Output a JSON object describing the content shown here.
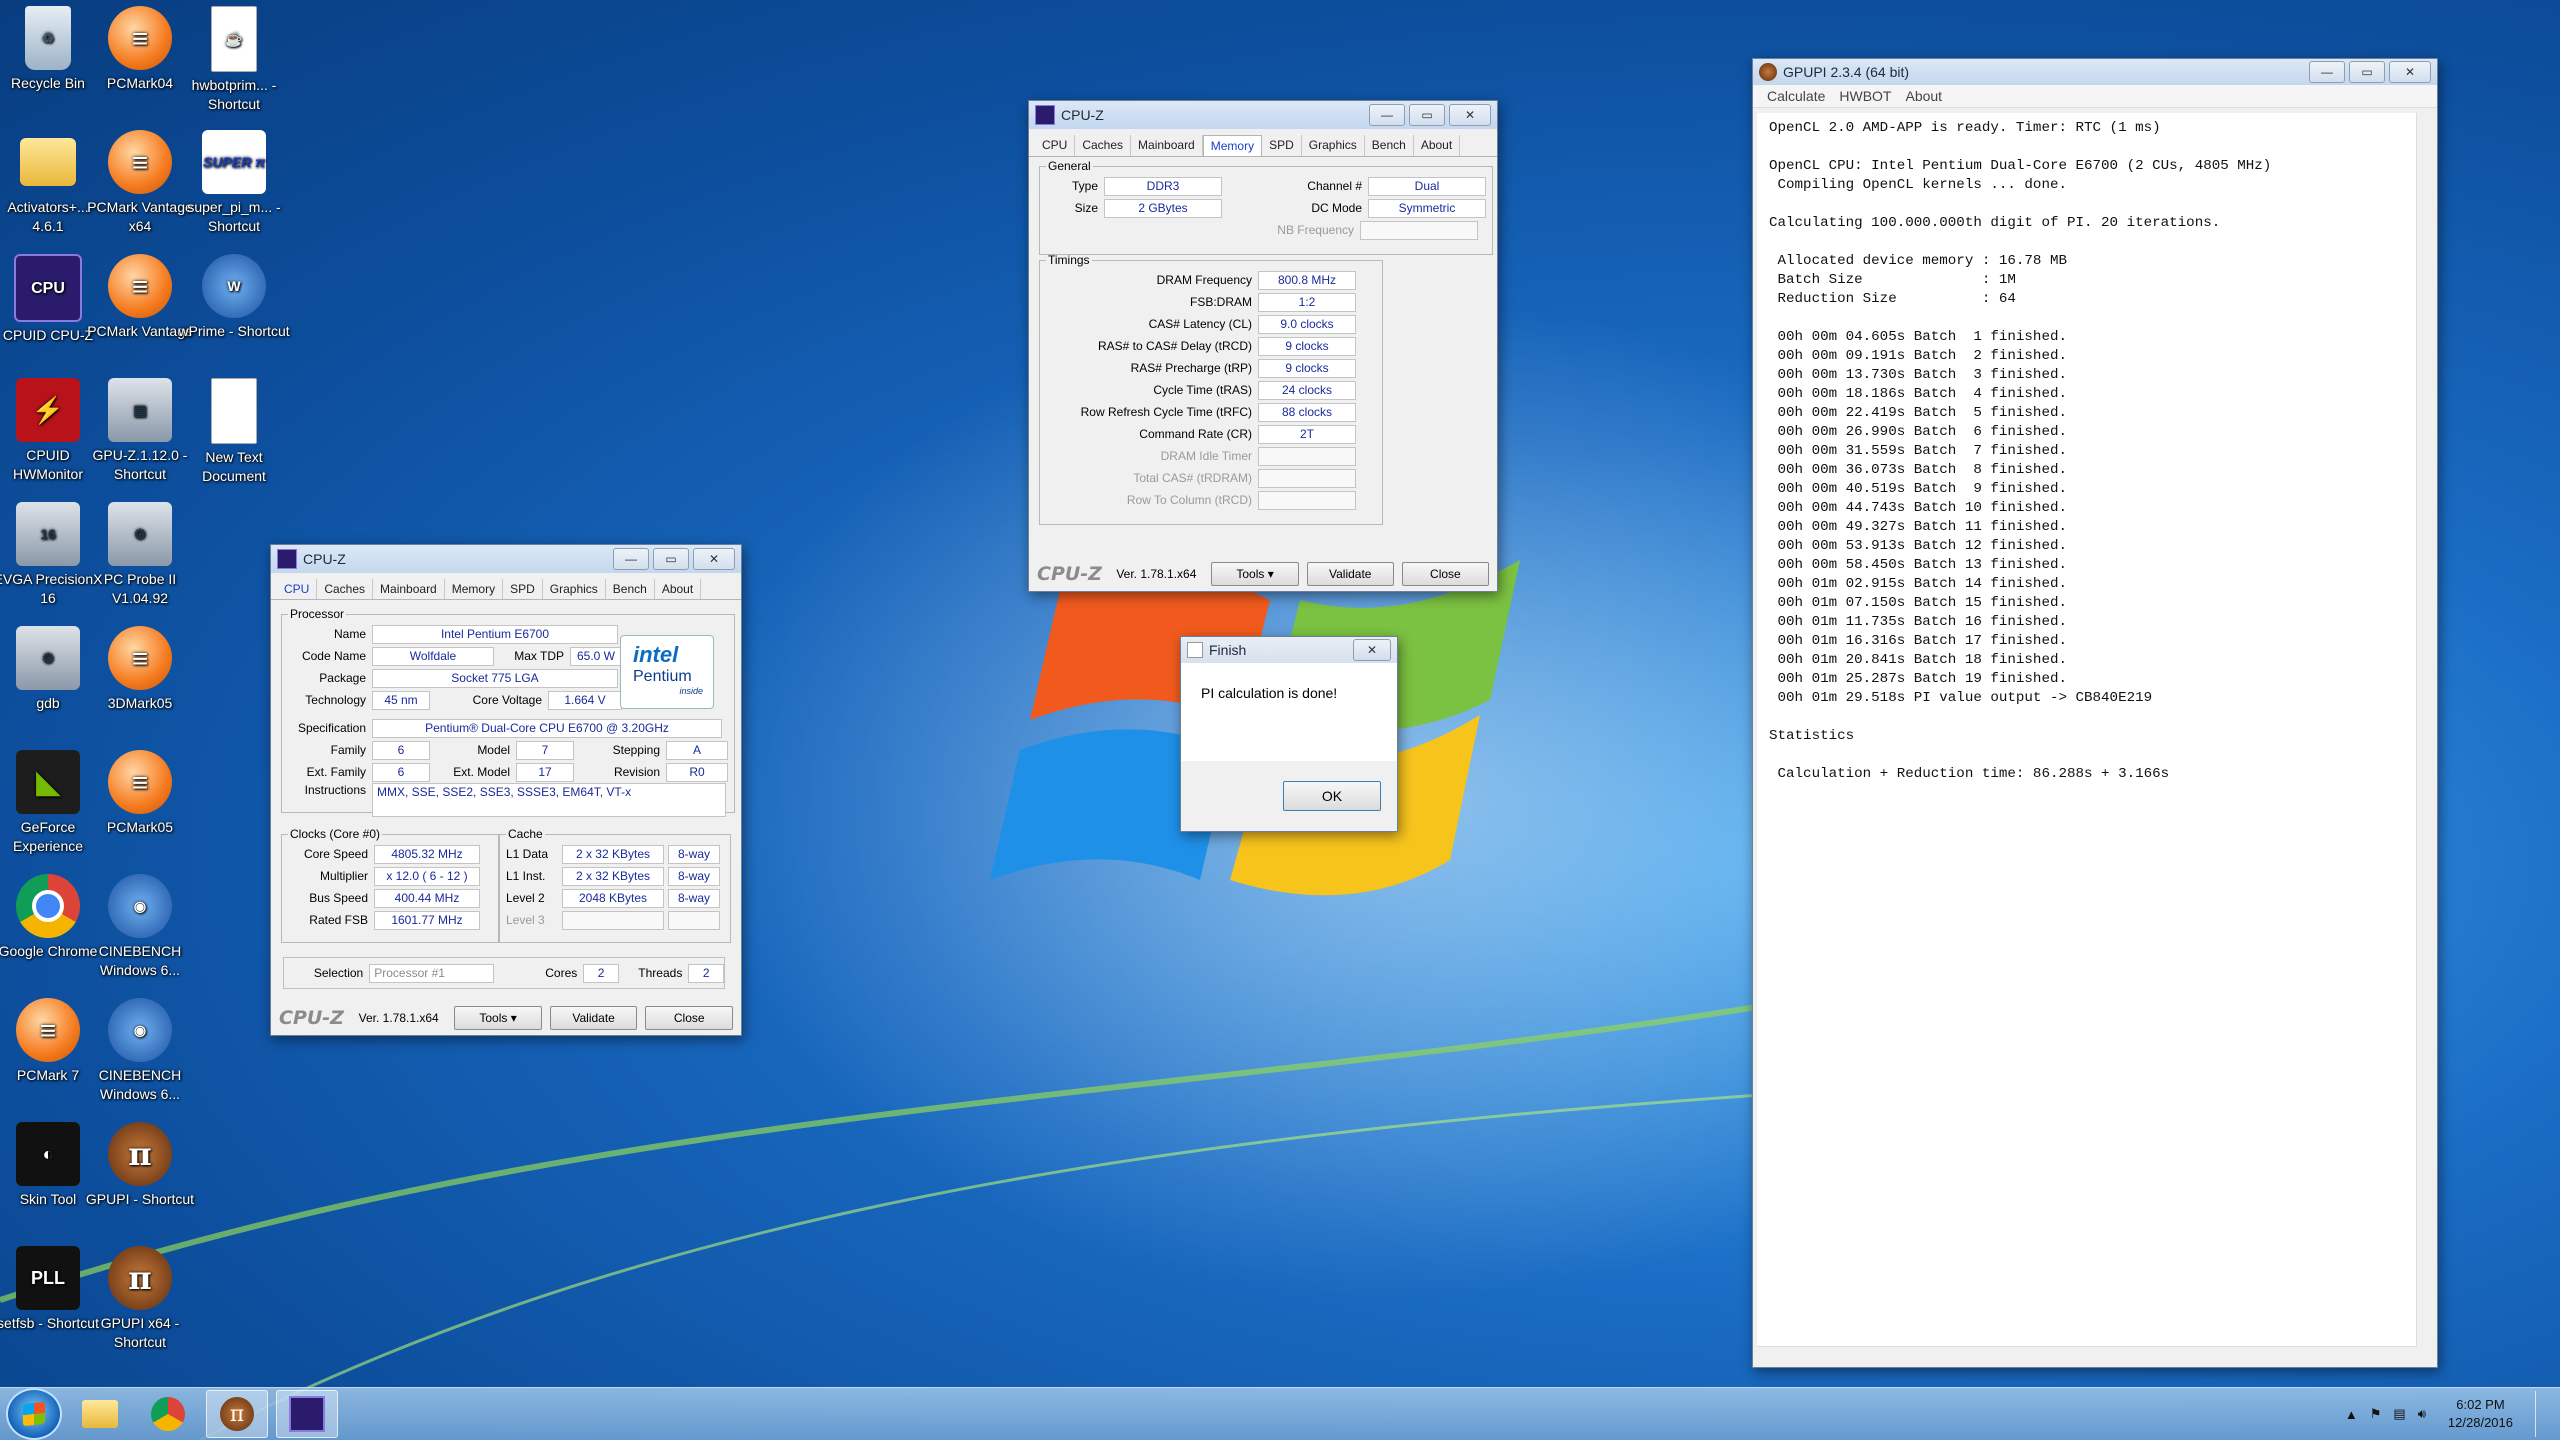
{
  "desktop_icons": [
    {
      "label": "Recycle Bin"
    },
    {
      "label": "PCMark04"
    },
    {
      "label": "hwbotprim... - Shortcut"
    },
    {
      "label": "Activators+... 4.6.1"
    },
    {
      "label": "PCMark Vantage x64"
    },
    {
      "label": "super_pi_m... - Shortcut"
    },
    {
      "label": "CPUID CPU-Z"
    },
    {
      "label": "PCMark Vantage"
    },
    {
      "label": "wPrime - Shortcut"
    },
    {
      "label": "CPUID HWMonitor"
    },
    {
      "label": "GPU-Z.1.12.0 - Shortcut"
    },
    {
      "label": "New Text Document"
    },
    {
      "label": "EVGA PrecisionX 16"
    },
    {
      "label": "PC Probe II V1.04.92"
    },
    {
      "label": "gdb"
    },
    {
      "label": "3DMark05"
    },
    {
      "label": "GeForce Experience"
    },
    {
      "label": "PCMark05"
    },
    {
      "label": "Google Chrome"
    },
    {
      "label": "CINEBENCH Windows 6..."
    },
    {
      "label": "PCMark 7"
    },
    {
      "label": "CINEBENCH Windows 6..."
    },
    {
      "label": "Skin Tool"
    },
    {
      "label": "GPUPI - Shortcut"
    },
    {
      "label": "setfsb - Shortcut"
    },
    {
      "label": "GPUPI x64 - Shortcut"
    }
  ],
  "cpuz_cpu": {
    "title": "CPU-Z",
    "tabs": [
      "CPU",
      "Caches",
      "Mainboard",
      "Memory",
      "SPD",
      "Graphics",
      "Bench",
      "About"
    ],
    "processor_legend": "Processor",
    "name_label": "Name",
    "name": "Intel Pentium E6700",
    "codename_label": "Code Name",
    "codename": "Wolfdale",
    "maxtdp_label": "Max TDP",
    "maxtdp": "65.0 W",
    "package_label": "Package",
    "package": "Socket 775 LGA",
    "tech_label": "Technology",
    "tech": "45 nm",
    "voltage_label": "Core Voltage",
    "voltage": "1.664 V",
    "spec_label": "Specification",
    "spec": "Pentium® Dual-Core  CPU     E6700  @ 3.20GHz",
    "family_label": "Family",
    "family": "6",
    "model_label": "Model",
    "model": "7",
    "stepping_label": "Stepping",
    "stepping": "A",
    "extfamily_label": "Ext. Family",
    "extfamily": "6",
    "extmodel_label": "Ext. Model",
    "extmodel": "17",
    "revision_label": "Revision",
    "revision": "R0",
    "instr_label": "Instructions",
    "instr": "MMX, SSE, SSE2, SSE3, SSSE3, EM64T, VT-x",
    "intel_logo_text": "intel",
    "intel_logo_sub": "Pentium",
    "intel_logo_inside": "inside",
    "clocks_legend": "Clocks (Core #0)",
    "corespeed_label": "Core Speed",
    "corespeed": "4805.32 MHz",
    "multiplier_label": "Multiplier",
    "multiplier": "x 12.0 ( 6 - 12 )",
    "busspeed_label": "Bus Speed",
    "busspeed": "400.44 MHz",
    "ratedfsb_label": "Rated FSB",
    "ratedfsb": "1601.77 MHz",
    "cache_legend": "Cache",
    "l1data_label": "L1 Data",
    "l1data": "2 x 32 KBytes",
    "l1data_way": "8-way",
    "l1inst_label": "L1 Inst.",
    "l1inst": "2 x 32 KBytes",
    "l1inst_way": "8-way",
    "l2_label": "Level 2",
    "l2": "2048 KBytes",
    "l2_way": "8-way",
    "l3_label": "Level 3",
    "selection_label": "Selection",
    "selection": "Processor #1",
    "cores_label": "Cores",
    "cores": "2",
    "threads_label": "Threads",
    "threads": "2",
    "brand": "CPU-Z",
    "version": "Ver. 1.78.1.x64",
    "tools": "Tools",
    "validate": "Validate",
    "close": "Close"
  },
  "cpuz_mem": {
    "title": "CPU-Z",
    "tabs": [
      "CPU",
      "Caches",
      "Mainboard",
      "Memory",
      "SPD",
      "Graphics",
      "Bench",
      "About"
    ],
    "general_legend": "General",
    "type_label": "Type",
    "type": "DDR3",
    "channel_label": "Channel #",
    "channel": "Dual",
    "size_label": "Size",
    "size": "2 GBytes",
    "dcmode_label": "DC Mode",
    "dcmode": "Symmetric",
    "nbfreq_label": "NB Frequency",
    "timings_legend": "Timings",
    "timings": [
      {
        "label": "DRAM Frequency",
        "value": "800.8 MHz",
        "dim": false
      },
      {
        "label": "FSB:DRAM",
        "value": "1:2",
        "dim": false
      },
      {
        "label": "CAS# Latency (CL)",
        "value": "9.0 clocks",
        "dim": false
      },
      {
        "label": "RAS# to CAS# Delay (tRCD)",
        "value": "9 clocks",
        "dim": false
      },
      {
        "label": "RAS# Precharge (tRP)",
        "value": "9 clocks",
        "dim": false
      },
      {
        "label": "Cycle Time (tRAS)",
        "value": "24 clocks",
        "dim": false
      },
      {
        "label": "Row Refresh Cycle Time (tRFC)",
        "value": "88 clocks",
        "dim": false
      },
      {
        "label": "Command Rate (CR)",
        "value": "2T",
        "dim": false
      },
      {
        "label": "DRAM Idle Timer",
        "value": "",
        "dim": true
      },
      {
        "label": "Total CAS# (tRDRAM)",
        "value": "",
        "dim": true
      },
      {
        "label": "Row To Column (tRCD)",
        "value": "",
        "dim": true
      }
    ],
    "brand": "CPU-Z",
    "version": "Ver. 1.78.1.x64",
    "tools": "Tools",
    "validate": "Validate",
    "close": "Close"
  },
  "finish_dialog": {
    "title": "Finish",
    "message": "PI calculation is done!",
    "ok": "OK"
  },
  "gpupi": {
    "title": "GPUPI 2.3.4 (64 bit)",
    "menu": [
      "Calculate",
      "HWBOT",
      "About"
    ],
    "log": [
      "OpenCL 2.0 AMD-APP is ready. Timer: RTC (1 ms)",
      "",
      "OpenCL CPU: Intel Pentium Dual-Core E6700 (2 CUs, 4805 MHz)",
      " Compiling OpenCL kernels ... done.",
      "",
      "Calculating 100.000.000th digit of PI. 20 iterations.",
      "",
      " Allocated device memory : 16.78 MB",
      " Batch Size              : 1M",
      " Reduction Size          : 64",
      "",
      " 00h 00m 04.605s Batch  1 finished.",
      " 00h 00m 09.191s Batch  2 finished.",
      " 00h 00m 13.730s Batch  3 finished.",
      " 00h 00m 18.186s Batch  4 finished.",
      " 00h 00m 22.419s Batch  5 finished.",
      " 00h 00m 26.990s Batch  6 finished.",
      " 00h 00m 31.559s Batch  7 finished.",
      " 00h 00m 36.073s Batch  8 finished.",
      " 00h 00m 40.519s Batch  9 finished.",
      " 00h 00m 44.743s Batch 10 finished.",
      " 00h 00m 49.327s Batch 11 finished.",
      " 00h 00m 53.913s Batch 12 finished.",
      " 00h 00m 58.450s Batch 13 finished.",
      " 00h 01m 02.915s Batch 14 finished.",
      " 00h 01m 07.150s Batch 15 finished.",
      " 00h 01m 11.735s Batch 16 finished.",
      " 00h 01m 16.316s Batch 17 finished.",
      " 00h 01m 20.841s Batch 18 finished.",
      " 00h 01m 25.287s Batch 19 finished.",
      " 00h 01m 29.518s PI value output -> CB840E219",
      "",
      "Statistics",
      "",
      " Calculation + Reduction time: 86.288s + 3.166s"
    ]
  },
  "taskbar": {
    "time": "6:02 PM",
    "date": "12/28/2016"
  }
}
